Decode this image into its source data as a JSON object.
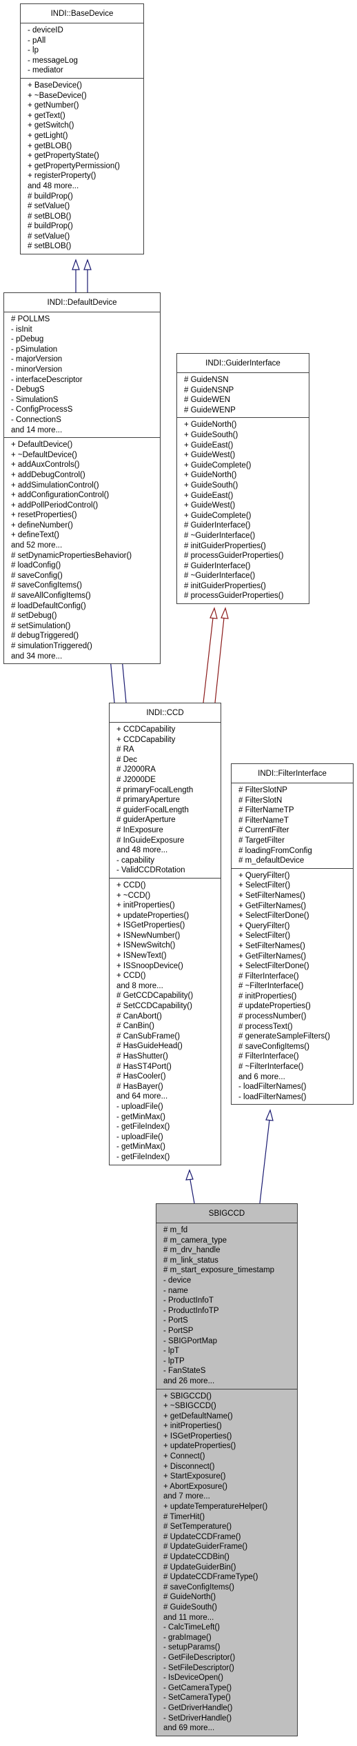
{
  "diagram": {
    "type": "class-inheritance",
    "classes": {
      "base_device": {
        "name": "INDI::BaseDevice",
        "attributes": [
          "- deviceID",
          "- pAll",
          "- lp",
          "- messageLog",
          "- mediator"
        ],
        "methods": [
          "+ BaseDevice()",
          "+ ~BaseDevice()",
          "+ getNumber()",
          "+ getText()",
          "+ getSwitch()",
          "+ getLight()",
          "+ getBLOB()",
          "+ getPropertyState()",
          "+ getPropertyPermission()",
          "+ registerProperty()",
          "and 48 more...",
          "# buildProp()",
          "# setValue()",
          "# setBLOB()",
          "# buildProp()",
          "# setValue()",
          "# setBLOB()"
        ]
      },
      "default_device": {
        "name": "INDI::DefaultDevice",
        "attributes": [
          "# POLLMS",
          "- isInit",
          "- pDebug",
          "- pSimulation",
          "- majorVersion",
          "- minorVersion",
          "- interfaceDescriptor",
          "- DebugS",
          "- SimulationS",
          "- ConfigProcessS",
          "- ConnectionS",
          "and 14 more..."
        ],
        "methods": [
          "+ DefaultDevice()",
          "+ ~DefaultDevice()",
          "+ addAuxControls()",
          "+ addDebugControl()",
          "+ addSimulationControl()",
          "+ addConfigurationControl()",
          "+ addPollPeriodControl()",
          "+ resetProperties()",
          "+ defineNumber()",
          "+ defineText()",
          "and 52 more...",
          "# setDynamicPropertiesBehavior()",
          "# loadConfig()",
          "# saveConfig()",
          "# saveConfigItems()",
          "# saveAllConfigItems()",
          "# loadDefaultConfig()",
          "# setDebug()",
          "# setSimulation()",
          "# debugTriggered()",
          "# simulationTriggered()",
          "and 34 more..."
        ]
      },
      "guider_interface": {
        "name": "INDI::GuiderInterface",
        "attributes": [
          "# GuideNSN",
          "# GuideNSNP",
          "# GuideWEN",
          "# GuideWENP"
        ],
        "methods": [
          "+ GuideNorth()",
          "+ GuideSouth()",
          "+ GuideEast()",
          "+ GuideWest()",
          "+ GuideComplete()",
          "+ GuideNorth()",
          "+ GuideSouth()",
          "+ GuideEast()",
          "+ GuideWest()",
          "+ GuideComplete()",
          "# GuiderInterface()",
          "# ~GuiderInterface()",
          "# initGuiderProperties()",
          "# processGuiderProperties()",
          "# GuiderInterface()",
          "# ~GuiderInterface()",
          "# initGuiderProperties()",
          "# processGuiderProperties()"
        ]
      },
      "ccd": {
        "name": "INDI::CCD",
        "attributes": [
          "+ CCDCapability",
          "+ CCDCapability",
          "# RA",
          "# Dec",
          "# J2000RA",
          "# J2000DE",
          "# primaryFocalLength",
          "# primaryAperture",
          "# guiderFocalLength",
          "# guiderAperture",
          "# InExposure",
          "# InGuideExposure",
          "and 48 more...",
          "- capability",
          "- ValidCCDRotation"
        ],
        "methods": [
          "+ CCD()",
          "+ ~CCD()",
          "+ initProperties()",
          "+ updateProperties()",
          "+ ISGetProperties()",
          "+ ISNewNumber()",
          "+ ISNewSwitch()",
          "+ ISNewText()",
          "+ ISSnoopDevice()",
          "+ CCD()",
          "and 8 more...",
          "# GetCCDCapability()",
          "# SetCCDCapability()",
          "# CanAbort()",
          "# CanBin()",
          "# CanSubFrame()",
          "# HasGuideHead()",
          "# HasShutter()",
          "# HasST4Port()",
          "# HasCooler()",
          "# HasBayer()",
          "and 64 more...",
          "- uploadFile()",
          "- getMinMax()",
          "- getFileIndex()",
          "- uploadFile()",
          "- getMinMax()",
          "- getFileIndex()"
        ]
      },
      "filter_interface": {
        "name": "INDI::FilterInterface",
        "attributes": [
          "# FilterSlotNP",
          "# FilterSlotN",
          "# FilterNameTP",
          "# FilterNameT",
          "# CurrentFilter",
          "# TargetFilter",
          "# loadingFromConfig",
          "# m_defaultDevice"
        ],
        "methods": [
          "+ QueryFilter()",
          "+ SelectFilter()",
          "+ SetFilterNames()",
          "+ GetFilterNames()",
          "+ SelectFilterDone()",
          "+ QueryFilter()",
          "+ SelectFilter()",
          "+ SetFilterNames()",
          "+ GetFilterNames()",
          "+ SelectFilterDone()",
          "# FilterInterface()",
          "# ~FilterInterface()",
          "# initProperties()",
          "# updateProperties()",
          "# processNumber()",
          "# processText()",
          "# generateSampleFilters()",
          "# saveConfigItems()",
          "# FilterInterface()",
          "# ~FilterInterface()",
          "and 6 more...",
          "- loadFilterNames()",
          "- loadFilterNames()"
        ]
      },
      "sbigccd": {
        "name": "SBIGCCD",
        "attributes": [
          "# m_fd",
          "# m_camera_type",
          "# m_drv_handle",
          "# m_link_status",
          "# m_start_exposure_timestamp",
          "- device",
          "- name",
          "- ProductInfoT",
          "- ProductInfoTP",
          "- PortS",
          "- PortSP",
          "- SBIGPortMap",
          "- lpT",
          "- lpTP",
          "- FanStateS",
          "and 26 more..."
        ],
        "methods": [
          "+ SBIGCCD()",
          "+ ~SBIGCCD()",
          "+ getDefaultName()",
          "+ initProperties()",
          "+ ISGetProperties()",
          "+ updateProperties()",
          "+ Connect()",
          "+ Disconnect()",
          "+ StartExposure()",
          "+ AbortExposure()",
          "and 7 more...",
          "+ updateTemperatureHelper()",
          "# TimerHit()",
          "# SetTemperature()",
          "# UpdateCCDFrame()",
          "# UpdateGuiderFrame()",
          "# UpdateCCDBin()",
          "# UpdateGuiderBin()",
          "# UpdateCCDFrameType()",
          "# saveConfigItems()",
          "# GuideNorth()",
          "# GuideSouth()",
          "and 11 more...",
          "- CalcTimeLeft()",
          "- grabImage()",
          "- setupParams()",
          "- GetFileDescriptor()",
          "- SetFileDescriptor()",
          "- IsDeviceOpen()",
          "- GetCameraType()",
          "- SetCameraType()",
          "- GetDriverHandle()",
          "- SetDriverHandle()",
          "and 69 more..."
        ]
      }
    },
    "edges": [
      {
        "from": "default_device",
        "to": "base_device",
        "kind": "public-inheritance",
        "color": "#191970",
        "count": 2
      },
      {
        "from": "ccd",
        "to": "default_device",
        "kind": "public-inheritance",
        "color": "#191970",
        "count": 2
      },
      {
        "from": "ccd",
        "to": "guider_interface",
        "kind": "protected-inheritance",
        "color": "#8b1a1a",
        "count": 2
      },
      {
        "from": "sbigccd",
        "to": "ccd",
        "kind": "public-inheritance",
        "color": "#191970",
        "count": 1
      },
      {
        "from": "sbigccd",
        "to": "filter_interface",
        "kind": "public-inheritance",
        "color": "#191970",
        "count": 1
      }
    ],
    "colors": {
      "focus_fill": "#bfbfbf",
      "box_border": "#404040",
      "public_edge": "#191970",
      "protected_edge": "#8b1a1a"
    }
  }
}
